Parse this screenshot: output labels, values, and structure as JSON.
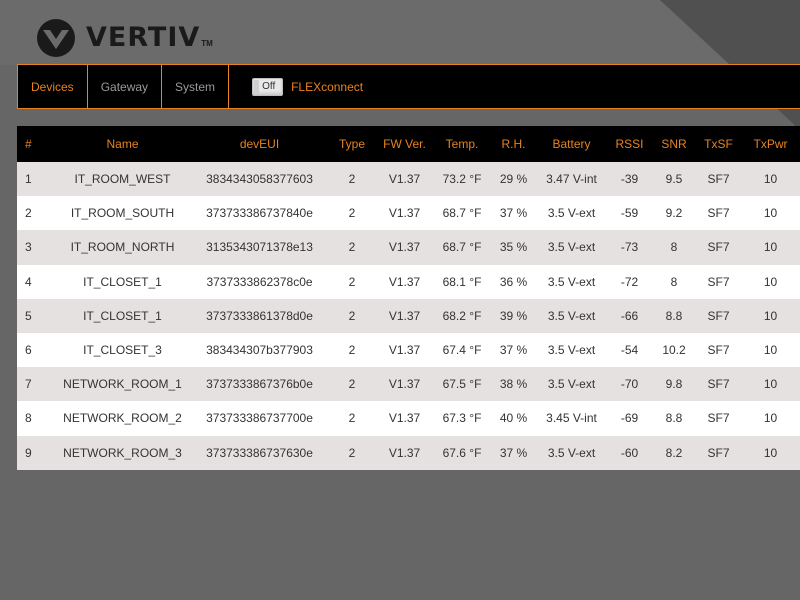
{
  "brand": {
    "name": "VERTIV",
    "tm": "TM"
  },
  "nav": {
    "tabs": [
      {
        "label": "Devices",
        "active": true
      },
      {
        "label": "Gateway",
        "active": false
      },
      {
        "label": "System",
        "active": false
      }
    ],
    "toggle_label": "Off",
    "flex_label": "FLEXconnect"
  },
  "colors": {
    "accent": "#e8821e",
    "header_bg": "#000000",
    "row_odd": "#e6e1e1",
    "row_even": "#ffffff",
    "page_bg": "#666666"
  },
  "table": {
    "headers": [
      "#",
      "Name",
      "devEUI",
      "Type",
      "FW Ver.",
      "Temp.",
      "R.H.",
      "Battery",
      "RSSI",
      "SNR",
      "TxSF",
      "TxPwr"
    ],
    "rows": [
      [
        "1",
        "IT_ROOM_WEST",
        "3834343058377603",
        "2",
        "V1.37",
        "73.2 °F",
        "29 %",
        "3.47 V-int",
        "-39",
        "9.5",
        "SF7",
        "10"
      ],
      [
        "2",
        "IT_ROOM_SOUTH",
        "373733386737840e",
        "2",
        "V1.37",
        "68.7 °F",
        "37 %",
        "3.5 V-ext",
        "-59",
        "9.2",
        "SF7",
        "10"
      ],
      [
        "3",
        "IT_ROOM_NORTH",
        "3135343071378e13",
        "2",
        "V1.37",
        "68.7 °F",
        "35 %",
        "3.5 V-ext",
        "-73",
        "8",
        "SF7",
        "10"
      ],
      [
        "4",
        "IT_CLOSET_1",
        "3737333862378c0e",
        "2",
        "V1.37",
        "68.1 °F",
        "36 %",
        "3.5 V-ext",
        "-72",
        "8",
        "SF7",
        "10"
      ],
      [
        "5",
        "IT_CLOSET_1",
        "3737333861378d0e",
        "2",
        "V1.37",
        "68.2 °F",
        "39 %",
        "3.5 V-ext",
        "-66",
        "8.8",
        "SF7",
        "10"
      ],
      [
        "6",
        "IT_CLOSET_3",
        "383434307b377903",
        "2",
        "V1.37",
        "67.4 °F",
        "37 %",
        "3.5 V-ext",
        "-54",
        "10.2",
        "SF7",
        "10"
      ],
      [
        "7",
        "NETWORK_ROOM_1",
        "3737333867376b0e",
        "2",
        "V1.37",
        "67.5 °F",
        "38 %",
        "3.5 V-ext",
        "-70",
        "9.8",
        "SF7",
        "10"
      ],
      [
        "8",
        "NETWORK_ROOM_2",
        "373733386737700e",
        "2",
        "V1.37",
        "67.3 °F",
        "40 %",
        "3.45 V-int",
        "-69",
        "8.8",
        "SF7",
        "10"
      ],
      [
        "9",
        "NETWORK_ROOM_3",
        "373733386737630e",
        "2",
        "V1.37",
        "67.6 °F",
        "37 %",
        "3.5 V-ext",
        "-60",
        "8.2",
        "SF7",
        "10"
      ]
    ]
  }
}
